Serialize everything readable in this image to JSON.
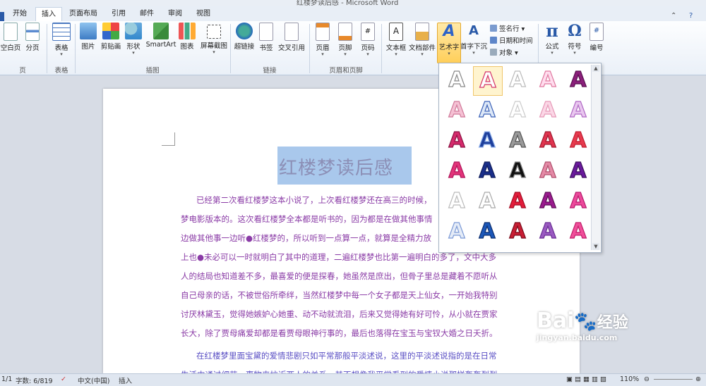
{
  "window": {
    "title": "红楼梦读后感 - Microsoft Word"
  },
  "tabs": [
    {
      "label": "开始"
    },
    {
      "label": "插入"
    },
    {
      "label": "页面布局"
    },
    {
      "label": "引用"
    },
    {
      "label": "邮件"
    },
    {
      "label": "审阅"
    },
    {
      "label": "视图"
    }
  ],
  "ribbon": {
    "pages": {
      "blank_page": "空白页",
      "page_break": "分页",
      "group": "页"
    },
    "tables": {
      "table": "表格",
      "group": "表格"
    },
    "illustrations": {
      "picture": "图片",
      "clipart": "剪贴画",
      "shapes": "形状",
      "smartart": "SmartArt",
      "chart": "图表",
      "screenshot": "屏幕截图",
      "group": "插图"
    },
    "links": {
      "hyperlink": "超链接",
      "bookmark": "书签",
      "crossref": "交叉引用",
      "group": "链接"
    },
    "header_footer": {
      "header": "页眉",
      "footer": "页脚",
      "page_number": "页码",
      "group": "页眉和页脚"
    },
    "text": {
      "textbox": "文本框",
      "quickparts": "文档部件",
      "wordart": "艺术字",
      "dropcap": "首字下沉",
      "signature": "签名行",
      "datetime": "日期和时间",
      "object": "对象"
    },
    "symbols": {
      "equation": "公式",
      "symbol": "符号",
      "numbering": "编号"
    }
  },
  "document": {
    "title": "红楼梦读后感",
    "para1": [
      "已经第二次看红楼梦这本小说了，上次看红楼梦还在高三的时候，",
      "梦电影版本的。这次看红楼梦全本都是听书的，因为都是在做其他事情",
      "边做其他事一边听●红楼梦的，所以听到一点算一点，就算是全精力放",
      "上也●未必可以一时就明白了其中的道理，二遍红楼梦也比第一遍明白的多了，文中大多",
      "人的结局也知道差不多，最喜爱的便是探春，她虽然是庶出，但骨子里总是藏着不愿听从",
      "自己母亲的话，不被世俗所牵绊，当然红楼梦中每一个女子都是天上仙女，一开始我特别",
      "讨厌林黛玉，觉得她嫉妒心她重、动不动就流泪，后来又觉得她有好可怜，从小就在贾家",
      "长大，除了贾母痛爱却都是看贾母眼神行事的，最后也落得在宝玉与宝钗大婚之日夭折。"
    ],
    "para2": [
      "在红楼梦里面宝黛的爱情悲剧只如平常那般平淡述说，这里的平淡述说指的是在日常",
      "生活中通过细节，事物来拉近两人的关系，其不想像我平常看到的爱情小说那样轰轰烈烈"
    ]
  },
  "wordart_gallery": {
    "glyph": "A",
    "rows": 6,
    "cols": 5
  },
  "statusbar": {
    "page": "1/1",
    "words": "字数: 6/819",
    "language": "中文(中国)",
    "mode": "插入",
    "zoom": "110%"
  },
  "watermark": {
    "brand": "Bai",
    "brand2": "经验",
    "url": "jingyan.baidu.com"
  }
}
